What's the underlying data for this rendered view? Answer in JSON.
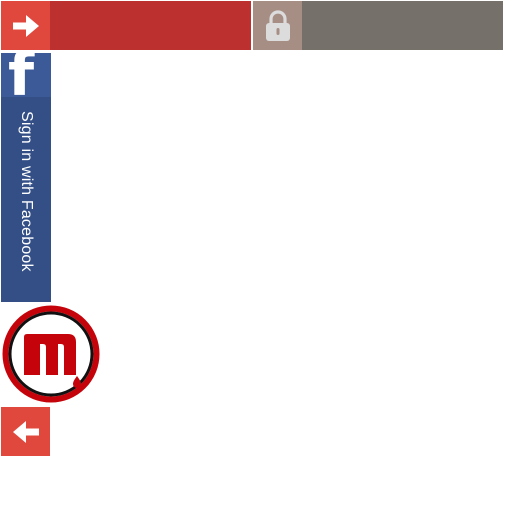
{
  "topbar": {
    "primary_icon": "arrow-right-icon",
    "secondary_icon": "lock-icon"
  },
  "facebook": {
    "icon": "facebook-f-icon",
    "logo_letter": "f",
    "label": "Sign in with Facebook"
  },
  "brand": {
    "icon": "m-brand-logo-icon"
  },
  "back": {
    "icon": "arrow-left-icon"
  },
  "colors": {
    "primary_bar": "#bd3030",
    "primary_icon_bg": "#e0483d",
    "secondary_bar": "#76706b",
    "secondary_icon_bg": "#a68e85",
    "facebook_dark": "#334f86",
    "facebook_light": "#3c5a98",
    "brand_red": "#c4040a"
  }
}
